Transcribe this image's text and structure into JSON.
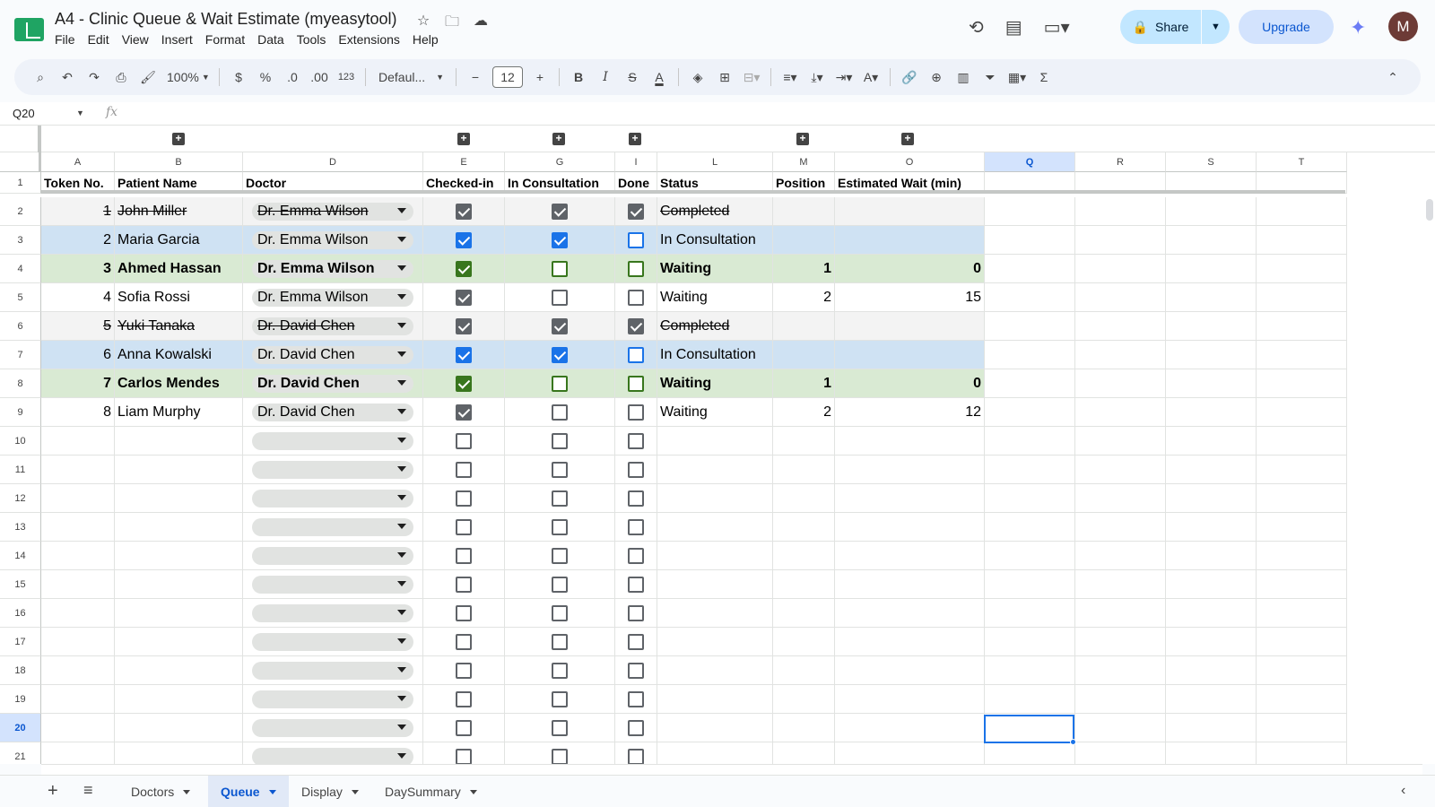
{
  "title": "A4 - Clinic Queue & Wait Estimate (myeasytool)",
  "menu": [
    "File",
    "Edit",
    "View",
    "Insert",
    "Format",
    "Data",
    "Tools",
    "Extensions",
    "Help"
  ],
  "share_label": "Share",
  "upgrade_label": "Upgrade",
  "avatar_initial": "M",
  "toolbar": {
    "zoom": "100%",
    "currency": "$",
    "percent": "%",
    "dec_decrease": ".0",
    "dec_increase": ".00",
    "format_123": "123",
    "font": "Defaul...",
    "font_size": "12",
    "bold": "B",
    "italic": "I",
    "sigma": "Σ"
  },
  "name_box": "Q20",
  "fx_label": "fx",
  "columns": [
    "A",
    "B",
    "D",
    "E",
    "G",
    "I",
    "L",
    "M",
    "O",
    "Q",
    "R",
    "S",
    "T"
  ],
  "headers": [
    "Token No.",
    "Patient Name",
    "Doctor",
    "Checked-in",
    "In Consultation",
    "Done",
    "Status",
    "Position",
    "Estimated Wait (min)"
  ],
  "rows": [
    {
      "num": "2",
      "token": "1",
      "patient": "John Miller",
      "doctor": "Dr. Emma Wilson",
      "checked_in": true,
      "in_consult": true,
      "done": true,
      "status": "Completed",
      "position": "",
      "wait": "",
      "style": "completed"
    },
    {
      "num": "3",
      "token": "2",
      "patient": "Maria Garcia",
      "doctor": "Dr. Emma Wilson",
      "checked_in": true,
      "in_consult": true,
      "done": false,
      "status": "In Consultation",
      "position": "",
      "wait": "",
      "style": "consult"
    },
    {
      "num": "4",
      "token": "3",
      "patient": "Ahmed Hassan",
      "doctor": "Dr. Emma Wilson",
      "checked_in": true,
      "in_consult": false,
      "done": false,
      "status": "Waiting",
      "position": "1",
      "wait": "0",
      "style": "first"
    },
    {
      "num": "5",
      "token": "4",
      "patient": "Sofia Rossi",
      "doctor": "Dr. Emma Wilson",
      "checked_in": true,
      "in_consult": false,
      "done": false,
      "status": "Waiting",
      "position": "2",
      "wait": "15",
      "style": "plain"
    },
    {
      "num": "6",
      "token": "5",
      "patient": "Yuki Tanaka",
      "doctor": "Dr. David Chen",
      "checked_in": true,
      "in_consult": true,
      "done": true,
      "status": "Completed",
      "position": "",
      "wait": "",
      "style": "completed"
    },
    {
      "num": "7",
      "token": "6",
      "patient": "Anna Kowalski",
      "doctor": "Dr. David Chen",
      "checked_in": true,
      "in_consult": true,
      "done": false,
      "status": "In Consultation",
      "position": "",
      "wait": "",
      "style": "consult"
    },
    {
      "num": "8",
      "token": "7",
      "patient": "Carlos Mendes",
      "doctor": "Dr. David Chen",
      "checked_in": true,
      "in_consult": false,
      "done": false,
      "status": "Waiting",
      "position": "1",
      "wait": "0",
      "style": "first"
    },
    {
      "num": "9",
      "token": "8",
      "patient": "Liam Murphy",
      "doctor": "Dr. David Chen",
      "checked_in": true,
      "in_consult": false,
      "done": false,
      "status": "Waiting",
      "position": "2",
      "wait": "12",
      "style": "plain"
    }
  ],
  "empty_rows": [
    "10",
    "11",
    "12",
    "13",
    "14",
    "15",
    "16",
    "17",
    "18",
    "19",
    "20",
    "21"
  ],
  "active_row": "20",
  "sheets": [
    "Doctors",
    "Queue",
    "Display",
    "DaySummary"
  ],
  "active_sheet": "Queue",
  "colors": {
    "completed": "#f3f3f3",
    "consult": "#cfe2f3",
    "waiting_first": "#d9ead3",
    "accent": "#0b57d0"
  }
}
